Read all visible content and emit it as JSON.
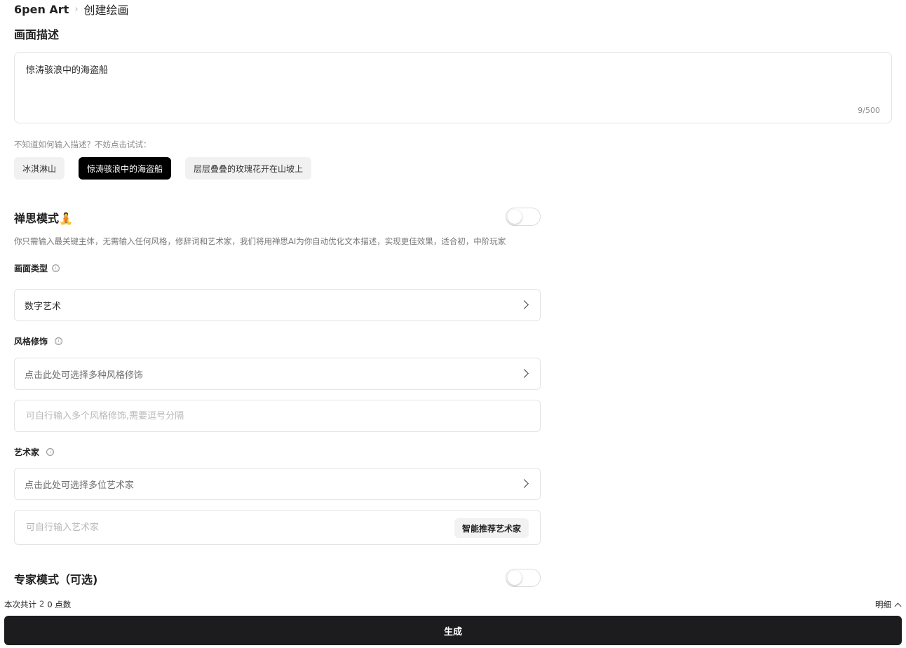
{
  "breadcrumb": {
    "root": "6pen Art",
    "separator": "›",
    "current": "创建绘画"
  },
  "description": {
    "title": "画面描述",
    "value": "惊涛骇浪中的海盗船",
    "count": "9/500"
  },
  "examples": {
    "hint": "不知道如何输入描述？不妨点击试试：",
    "chips": [
      {
        "label": "冰淇淋山",
        "active": false
      },
      {
        "label": "惊涛骇浪中的海盗船",
        "active": true
      },
      {
        "label": "层层叠叠的玫瑰花开在山坡上",
        "active": false
      }
    ]
  },
  "zen_mode": {
    "title": "禅思模式🧘",
    "enabled": false,
    "description": "你只需输入最关键主体，无需输入任何风格，修辞词和艺术家，我们将用禅思AI为你自动优化文本描述，实现更佳效果，适合初，中阶玩家"
  },
  "picture_type": {
    "label": "画面类型",
    "info_icon": "ⓘ",
    "value": "数字艺术"
  },
  "style": {
    "label": "风格修饰",
    "info_icon": "ⓘ",
    "select_placeholder": "点击此处可选择多种风格修饰",
    "input_placeholder": "可自行输入多个风格修饰,需要逗号分隔"
  },
  "artist": {
    "label": "艺术家",
    "info_icon": "ⓘ",
    "select_placeholder": "点击此处可选择多位艺术家",
    "input_placeholder": "可自行输入艺术家",
    "suggest_button": "智能推荐艺术家"
  },
  "expert_mode": {
    "title": "专家模式（可选)",
    "enabled": false
  },
  "footer": {
    "cost_prefix": "本次共计",
    "cost_value": "2",
    "points": "0 点数",
    "detail_label": "明细",
    "generate_label": "生成"
  },
  "colors": {
    "primary_button": "#1c1c1e",
    "active_chip": "#000000",
    "chip_bg": "#f1f1f1",
    "border": "#e4e4e4"
  }
}
